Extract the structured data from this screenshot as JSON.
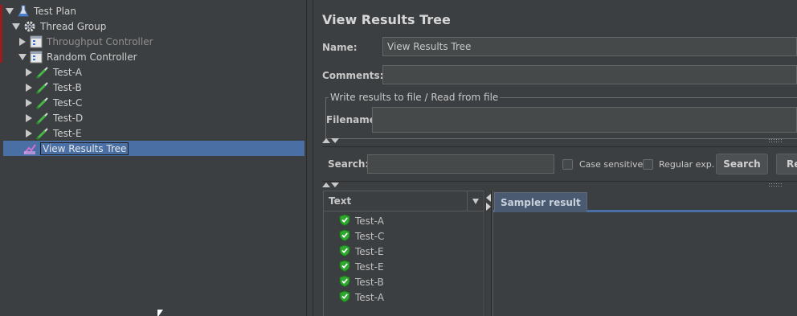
{
  "tree": {
    "items": [
      {
        "label": "Test Plan",
        "icon": "flask-icon"
      },
      {
        "label": "Thread Group",
        "icon": "gear-icon"
      },
      {
        "label": "Throughput Controller",
        "icon": "controller-icon"
      },
      {
        "label": "Random Controller",
        "icon": "controller-icon"
      },
      {
        "label": "Test-A",
        "icon": "pipette-icon"
      },
      {
        "label": "Test-B",
        "icon": "pipette-icon"
      },
      {
        "label": "Test-C",
        "icon": "pipette-icon"
      },
      {
        "label": "Test-D",
        "icon": "pipette-icon"
      },
      {
        "label": "Test-E",
        "icon": "pipette-icon"
      },
      {
        "label": "View Results Tree",
        "icon": "chart-icon"
      }
    ]
  },
  "panel": {
    "title": "View Results Tree",
    "name_label": "Name:",
    "name_value": "View Results Tree",
    "comments_label": "Comments:",
    "comments_value": "",
    "file_group_title": "Write results to file / Read from file",
    "filename_label": "Filename",
    "filename_value": ""
  },
  "search": {
    "label": "Search:",
    "value": "",
    "case_sensitive_label": "Case sensitive",
    "regex_label": "Regular exp.",
    "search_button": "Search",
    "reset_button": "Re"
  },
  "results": {
    "header": "Text",
    "items": [
      "Test-A",
      "Test-C",
      "Test-E",
      "Test-E",
      "Test-B",
      "Test-A"
    ],
    "status_icon": "shield-check-icon"
  },
  "detail": {
    "tab_label": "Sampler result"
  },
  "colors": {
    "background": "#3c3f41",
    "selection": "#4a6fa5",
    "success": "#3bb33b"
  }
}
